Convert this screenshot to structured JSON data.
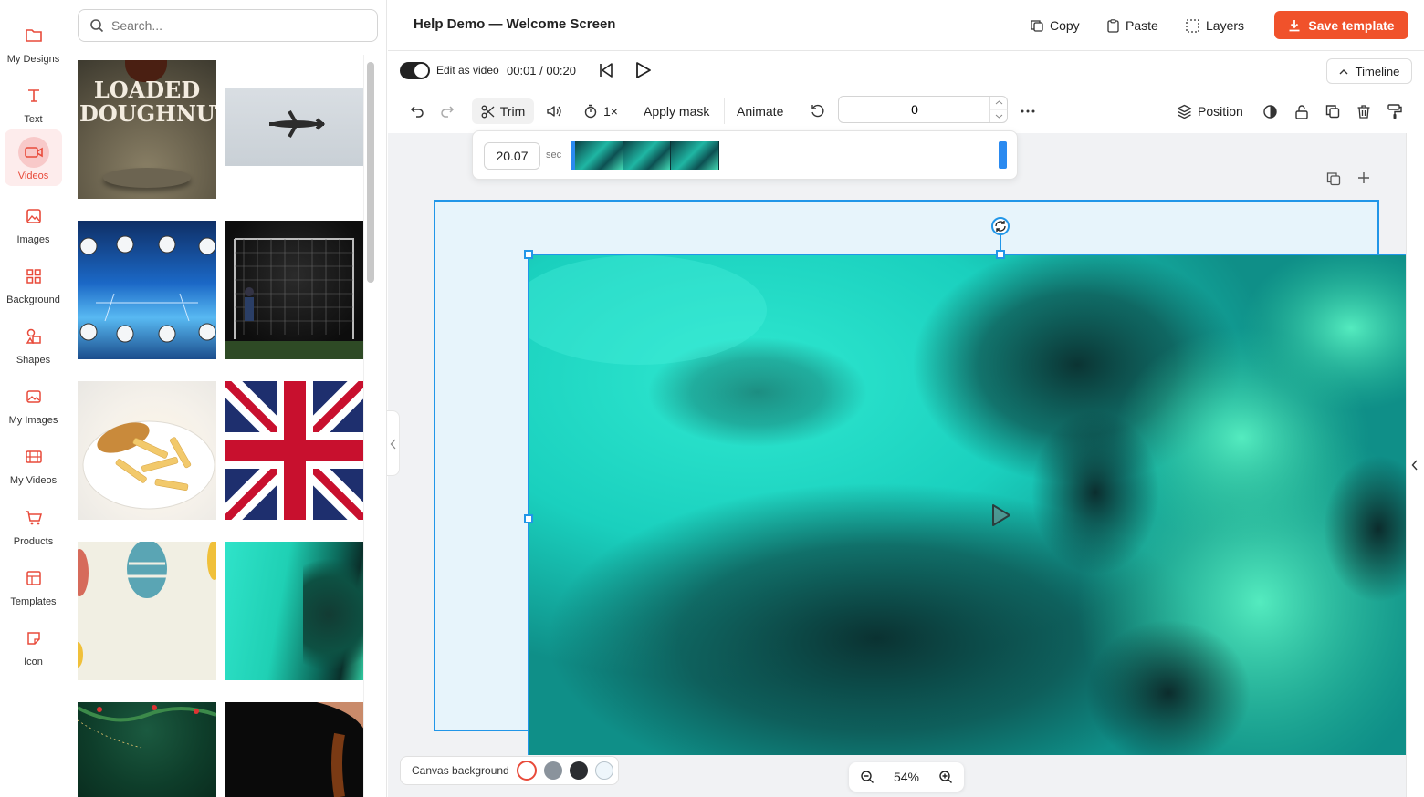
{
  "sidebar": {
    "items": [
      {
        "label": "My Designs",
        "icon": "folder-icon"
      },
      {
        "label": "Text",
        "icon": "text-icon"
      },
      {
        "label": "Videos",
        "icon": "video-icon",
        "active": true
      },
      {
        "label": "Images",
        "icon": "image-icon"
      },
      {
        "label": "Background",
        "icon": "grid-icon"
      },
      {
        "label": "Shapes",
        "icon": "shapes-icon"
      },
      {
        "label": "My Images",
        "icon": "my-images-icon"
      },
      {
        "label": "My Videos",
        "icon": "film-icon"
      },
      {
        "label": "Products",
        "icon": "cart-icon"
      },
      {
        "label": "Templates",
        "icon": "template-icon"
      },
      {
        "label": "Icon",
        "icon": "sticker-icon"
      }
    ]
  },
  "search": {
    "placeholder": "Search..."
  },
  "media": {
    "thumb1_text": "LOADED DOUGHNUTS"
  },
  "header": {
    "title": "Help Demo — Welcome Screen",
    "copy_label": "Copy",
    "paste_label": "Paste",
    "layers_label": "Layers",
    "save_label": "Save template"
  },
  "playback": {
    "edit_as_video_label": "Edit as video",
    "edit_as_video_on": true,
    "current_time": "00:01",
    "separator": "/",
    "total_time": "00:20",
    "timeline_label": "Timeline"
  },
  "toolbar": {
    "trim_label": "Trim",
    "speed_label": "1×",
    "apply_mask_label": "Apply mask",
    "animate_label": "Animate",
    "rotation_value": "0",
    "position_label": "Position"
  },
  "trim": {
    "duration_value": "20.07",
    "unit": "sec"
  },
  "canvas_bg": {
    "label": "Canvas background",
    "swatches": [
      "#ffffff",
      "#8a939c",
      "#2b2d31",
      "#eef6fb"
    ]
  },
  "zoom": {
    "value": "54%"
  },
  "colors": {
    "accent": "#f0522b",
    "selection": "#2196e8"
  }
}
